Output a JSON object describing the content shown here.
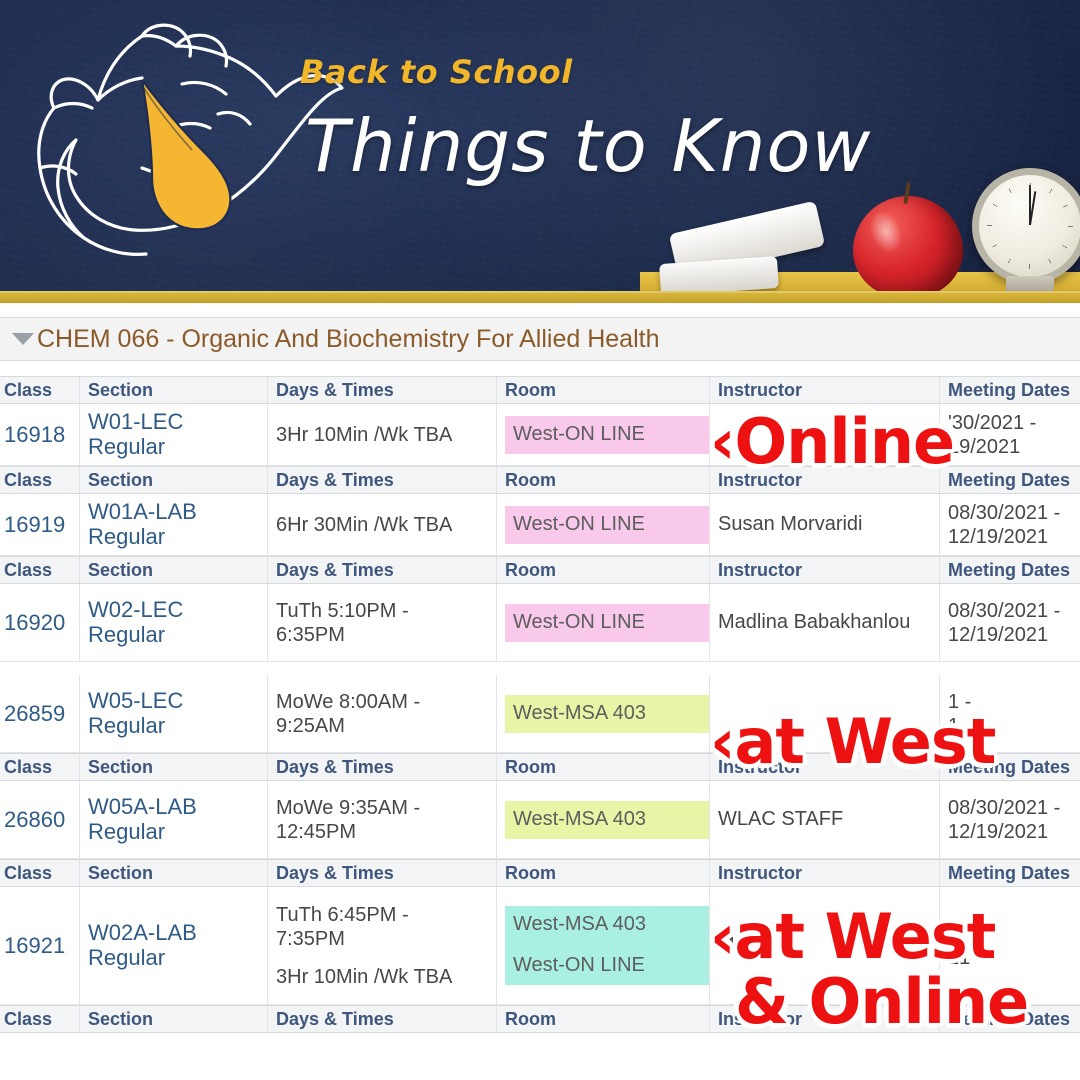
{
  "banner": {
    "eyebrow": "Back to School",
    "title": "Things to Know",
    "logo_icon": "wolf-mascot-logo",
    "decor": {
      "apple": "apple-icon",
      "chalk": "chalk-icon",
      "clock": "clock-icon"
    },
    "colors": {
      "chalkboard": "#1d2c50",
      "accent_yellow": "#f2b62b",
      "rule_yellow": "#cfae32"
    }
  },
  "course": {
    "toggle_icon": "collapse-triangle-icon",
    "title": "CHEM 066 - Organic And Biochemistry For Allied Health"
  },
  "table": {
    "columns": [
      "Class",
      "Section",
      "Days & Times",
      "Room",
      "Instructor",
      "Meeting Dates"
    ],
    "highlight_colors": {
      "online": "#f8c9ea",
      "in_person": "#e9f5a6",
      "hybrid": "#a9f0e3"
    },
    "rows": [
      {
        "class": "16918",
        "section_line1": "W01-LEC",
        "section_line2": "Regular",
        "days": [
          "3Hr 10Min /Wk TBA"
        ],
        "rooms": [
          "West-ON LINE"
        ],
        "room_style": "online",
        "instructor": "",
        "dates_line1": "'30/2021 -",
        "dates_line2": "19/2021",
        "header_above": true
      },
      {
        "class": "16919",
        "section_line1": "W01A-LAB",
        "section_line2": "Regular",
        "days": [
          "6Hr 30Min /Wk TBA"
        ],
        "rooms": [
          "West-ON LINE"
        ],
        "room_style": "online",
        "instructor": "Susan Morvaridi",
        "dates_line1": "08/30/2021 -",
        "dates_line2": "12/19/2021",
        "header_above": true
      },
      {
        "class": "16920",
        "section_line1": "W02-LEC",
        "section_line2": "Regular",
        "days": [
          "TuTh 5:10PM -",
          "6:35PM"
        ],
        "rooms": [
          "West-ON LINE"
        ],
        "room_style": "online",
        "instructor": "Madlina Babakhanlou",
        "dates_line1": "08/30/2021 -",
        "dates_line2": "12/19/2021",
        "header_above": true
      },
      {
        "class": "26859",
        "section_line1": "W05-LEC",
        "section_line2": "Regular",
        "days": [
          "MoWe 8:00AM -",
          "9:25AM"
        ],
        "rooms": [
          "West-MSA 403"
        ],
        "room_style": "in_person",
        "instructor": "",
        "dates_line1": "1 -",
        "dates_line2": "1",
        "header_above": false
      },
      {
        "class": "26860",
        "section_line1": "W05A-LAB",
        "section_line2": "Regular",
        "days": [
          "MoWe 9:35AM -",
          "12:45PM"
        ],
        "rooms": [
          "West-MSA 403"
        ],
        "room_style": "in_person",
        "instructor": "WLAC STAFF",
        "dates_line1": "08/30/2021 -",
        "dates_line2": "12/19/2021",
        "header_above": true
      },
      {
        "class": "16921",
        "section_line1": "W02A-LAB",
        "section_line2": "Regular",
        "days": [
          "TuTh 6:45PM -",
          "7:35PM",
          "3Hr 10Min /Wk TBA"
        ],
        "rooms": [
          "West-MSA 403",
          "West-ON LINE"
        ],
        "room_style": "hybrid",
        "instructor": "Ma",
        "dates_line1": "1 -",
        "dates_line2": "21 -",
        "header_above": true
      }
    ],
    "trailing_header": true
  },
  "annotations": [
    {
      "id": "online-1",
      "text": "‹Online",
      "color": "#ee1111"
    },
    {
      "id": "at-west-1",
      "text": "‹at West",
      "color": "#ee1111"
    },
    {
      "id": "at-west-2",
      "text": "‹at West",
      "color": "#ee1111"
    },
    {
      "id": "online-2",
      "text": "& Online",
      "color": "#ee1111"
    }
  ]
}
